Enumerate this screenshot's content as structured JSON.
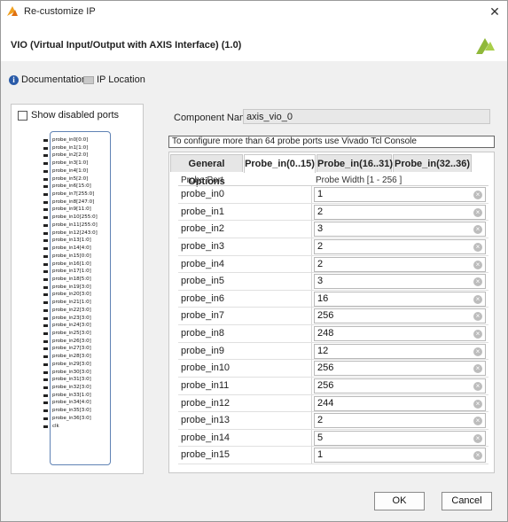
{
  "window": {
    "title": "Re-customize IP",
    "close_glyph": "✕"
  },
  "header": {
    "ip_title": "VIO (Virtual Input/Output with AXIS Interface) (1.0)",
    "logo_icon": "xilinx-logo"
  },
  "links": {
    "documentation": "Documentation",
    "ip_location": "IP Location"
  },
  "left_panel": {
    "show_disabled_label": "Show disabled ports",
    "ports": [
      "probe_in0[0:0]",
      "probe_in1[1:0]",
      "probe_in2[2:0]",
      "probe_in3[1:0]",
      "probe_in4[1:0]",
      "probe_in5[2:0]",
      "probe_in6[15:0]",
      "probe_in7[255:0]",
      "probe_in8[247:0]",
      "probe_in9[11:0]",
      "probe_in10[255:0]",
      "probe_in11[255:0]",
      "probe_in12[243:0]",
      "probe_in13[1:0]",
      "probe_in14[4:0]",
      "probe_in15[0:0]",
      "probe_in16[1:0]",
      "probe_in17[1:0]",
      "probe_in18[5:0]",
      "probe_in19[3:0]",
      "probe_in20[3:0]",
      "probe_in21[1:0]",
      "probe_in22[3:0]",
      "probe_in23[3:0]",
      "probe_in24[3:0]",
      "probe_in25[3:0]",
      "probe_in26[3:0]",
      "probe_in27[3:0]",
      "probe_in28[3:0]",
      "probe_in29[3:0]",
      "probe_in30[3:0]",
      "probe_in31[3:0]",
      "probe_in32[3:0]",
      "probe_in33[1:0]",
      "probe_in34[4:0]",
      "probe_in35[3:0]",
      "probe_in36[3:0]",
      "clk"
    ]
  },
  "component": {
    "label": "Component Name",
    "value": "axis_vio_0"
  },
  "info_bar": "To configure more than 64 probe ports use Vivado Tcl Console",
  "tabs": [
    "General Options",
    "Probe_in(0..15)",
    "Probe_in(16..31)",
    "Probe_in(32..36)"
  ],
  "grid": {
    "col_port": "Probe Port",
    "col_width": "Probe Width [1 - 256 ]",
    "rows": [
      {
        "port": "probe_in0",
        "value": "1"
      },
      {
        "port": "probe_in1",
        "value": "2"
      },
      {
        "port": "probe_in2",
        "value": "3"
      },
      {
        "port": "probe_in3",
        "value": "2"
      },
      {
        "port": "probe_in4",
        "value": "2"
      },
      {
        "port": "probe_in5",
        "value": "3"
      },
      {
        "port": "probe_in6",
        "value": "16"
      },
      {
        "port": "probe_in7",
        "value": "256"
      },
      {
        "port": "probe_in8",
        "value": "248"
      },
      {
        "port": "probe_in9",
        "value": "12"
      },
      {
        "port": "probe_in10",
        "value": "256"
      },
      {
        "port": "probe_in11",
        "value": "256"
      },
      {
        "port": "probe_in12",
        "value": "244"
      },
      {
        "port": "probe_in13",
        "value": "2"
      },
      {
        "port": "probe_in14",
        "value": "5"
      },
      {
        "port": "probe_in15",
        "value": "1"
      }
    ]
  },
  "buttons": {
    "ok": "OK",
    "cancel": "Cancel"
  }
}
